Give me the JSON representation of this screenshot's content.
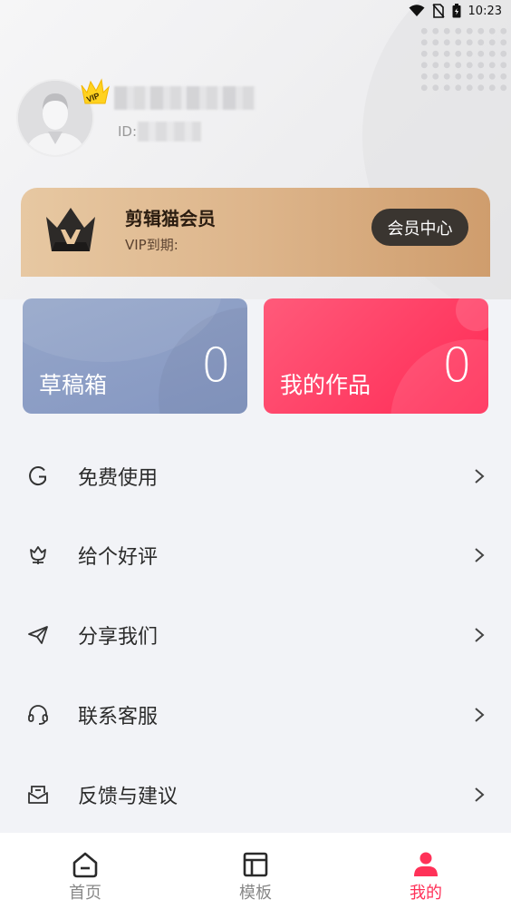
{
  "status_bar": {
    "time": "10:23"
  },
  "profile": {
    "id_label": "ID:",
    "vip_badge": "VIP"
  },
  "member": {
    "title": "剪辑猫会员",
    "subtitle": "VIP到期:",
    "button_label": "会员中心"
  },
  "stats": [
    {
      "label": "草稿箱",
      "count": "0"
    },
    {
      "label": "我的作品",
      "count": "0"
    }
  ],
  "menu": [
    {
      "label": "免费使用",
      "icon": "g-letter-icon"
    },
    {
      "label": "给个好评",
      "icon": "flower-icon"
    },
    {
      "label": "分享我们",
      "icon": "paper-plane-icon"
    },
    {
      "label": "联系客服",
      "icon": "headset-icon"
    },
    {
      "label": "反馈与建议",
      "icon": "mail-box-icon"
    }
  ],
  "nav": [
    {
      "label": "首页",
      "icon": "home-icon"
    },
    {
      "label": "模板",
      "icon": "template-icon"
    },
    {
      "label": "我的",
      "icon": "user-icon"
    }
  ],
  "colors": {
    "accent": "#ff3158",
    "member_gold": "#ddb58b",
    "drafts_card": "#8a9bc5",
    "works_card": "#ff3d62"
  }
}
